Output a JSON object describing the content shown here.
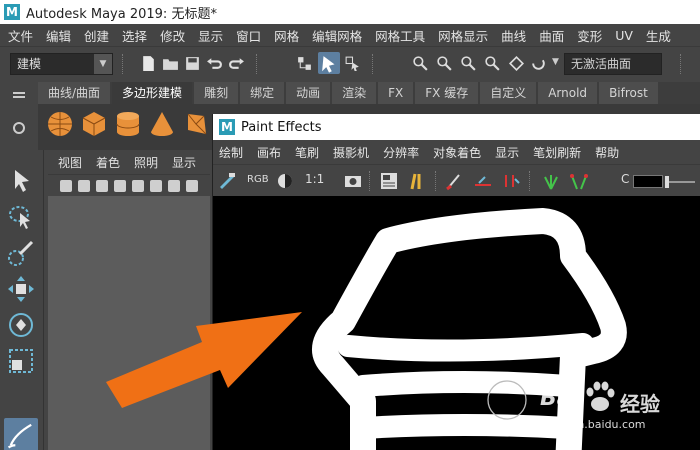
{
  "window": {
    "title": "Autodesk Maya 2019: 无标题*",
    "logo_letter": "M"
  },
  "menubar": {
    "items": [
      "文件",
      "编辑",
      "创建",
      "选择",
      "修改",
      "显示",
      "窗口",
      "网格",
      "编辑网格",
      "网格工具",
      "网格显示",
      "曲线",
      "曲面",
      "变形",
      "UV",
      "生成"
    ]
  },
  "toolbar": {
    "mode": "建模",
    "live_surface": "无激活曲面"
  },
  "shelf": {
    "tabs": [
      "曲线/曲面",
      "多边形建模",
      "雕刻",
      "绑定",
      "动画",
      "渲染",
      "FX",
      "FX 缓存",
      "自定义",
      "Arnold",
      "Bifrost"
    ],
    "active_tab": "多边形建模",
    "icons": [
      "poly-sphere-icon",
      "poly-cube-icon",
      "poly-cylinder-icon",
      "poly-cone-icon",
      "poly-torus-icon"
    ]
  },
  "toolbox": {
    "tools": [
      "select-tool-icon",
      "lasso-tool-icon",
      "paint-select-tool-icon",
      "move-tool-icon",
      "rotate-tool-icon",
      "scale-tool-icon",
      "paint-effects-tool-icon"
    ]
  },
  "viewport": {
    "menu": [
      "视图",
      "着色",
      "照明",
      "显示"
    ]
  },
  "paint_effects": {
    "title": "Paint Effects",
    "menu": [
      "绘制",
      "画布",
      "笔刷",
      "摄影机",
      "分辨率",
      "对象着色",
      "显示",
      "笔划刷新",
      "帮助"
    ],
    "rgb_label": "RGB",
    "ratio_label": "1:1",
    "color_label": "C"
  },
  "watermark": {
    "brand": "Bai",
    "brand2": "经验",
    "url": "jingyan.baidu.com"
  },
  "colors": {
    "accent": "#2a9bb5",
    "arrow": "#f07015",
    "shelf_icon": "#e8913a",
    "tool_blue": "#6fb9d6"
  }
}
